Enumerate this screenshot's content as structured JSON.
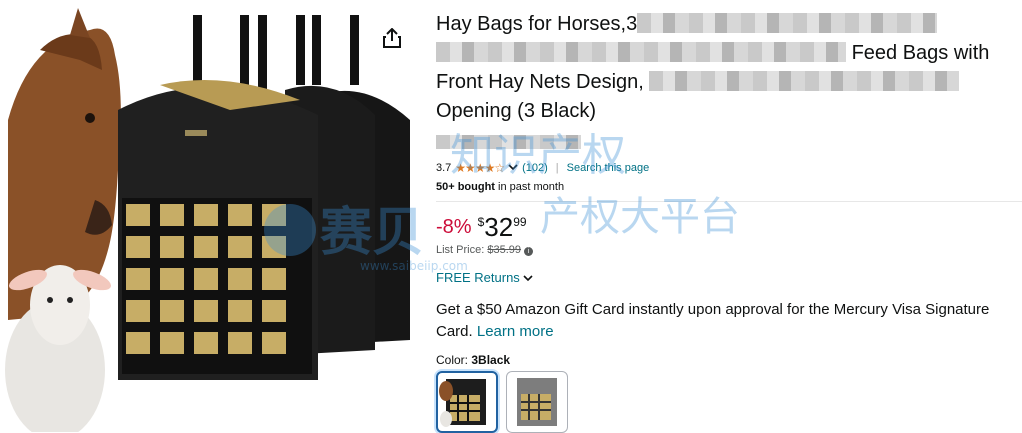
{
  "product": {
    "title_part1": "Hay Bags for Horses,3",
    "title_part2": "Feed Bags with",
    "title_part3": "Front Hay Nets Design,",
    "title_part4": "Opening (3 Black)"
  },
  "rating": {
    "value": "3.7",
    "stars_glyph": "★★★★☆",
    "count": "(102)",
    "separator": "|",
    "search_link": "Search this page"
  },
  "bought": {
    "count": "50+ bought",
    "suffix": "in past month"
  },
  "price": {
    "discount": "-8%",
    "currency": "$",
    "whole": "32",
    "fraction": "99",
    "list_label": "List Price:",
    "list_value": "$35.99",
    "info_glyph": "i"
  },
  "returns": {
    "label": "FREE Returns",
    "chevron": "⌄"
  },
  "promo": {
    "text": "Get a $50 Amazon Gift Card instantly upon approval for the Mercury Visa Signature Card.",
    "link": "Learn more"
  },
  "color": {
    "label": "Color:",
    "selected": "3Black"
  },
  "watermark": {
    "text1": "赛贝",
    "text2": "知识产权",
    "text3": "产权大平台",
    "url": "www.saibeiip.com"
  },
  "colors": {
    "link": "#007185",
    "discount": "#cc0c39",
    "star": "#de7921",
    "selected_border": "#2162a1"
  },
  "icons": {
    "share": "share-icon",
    "chevron": "chevron-down-icon",
    "info": "info-icon"
  }
}
